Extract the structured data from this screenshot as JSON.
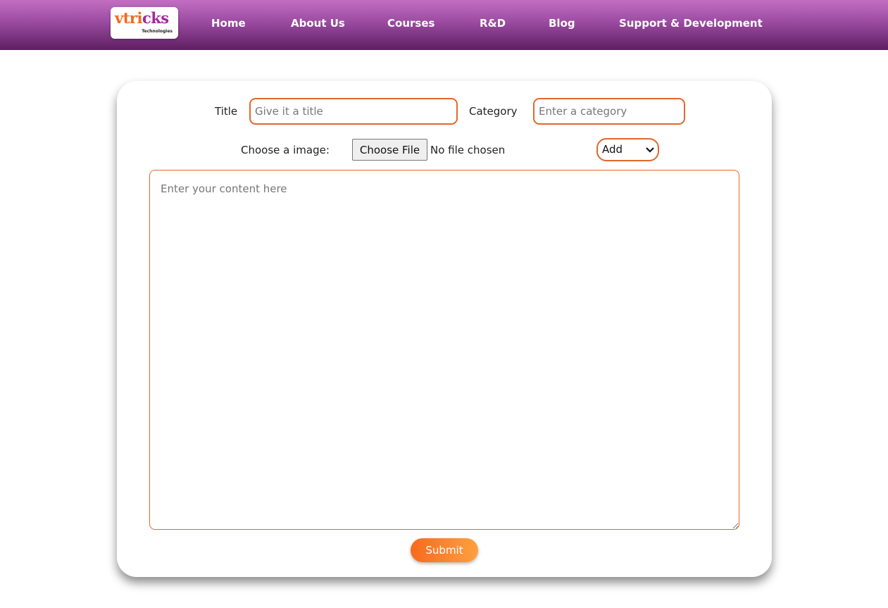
{
  "nav": {
    "logo": {
      "word_part1": "vtri",
      "word_part2": "cks",
      "subtitle": "Technologies"
    },
    "links": [
      "Home",
      "About Us",
      "Courses",
      "R&D",
      "Blog",
      "Support & Development"
    ]
  },
  "form": {
    "title_label": "Title",
    "title_placeholder": "Give it a title",
    "category_label": "Category",
    "category_placeholder": "Enter a category",
    "image_label": "Choose a image:",
    "file_button": "Choose File",
    "file_status": "No file chosen",
    "select_value": "Add",
    "content_placeholder": "Enter your content here",
    "submit_label": "Submit"
  },
  "colors": {
    "nav_top": "#c26fc2",
    "nav_bottom": "#5e1f60",
    "accent": "#e2672c",
    "submit_start": "#f76a1d",
    "submit_end": "#ffa040"
  }
}
